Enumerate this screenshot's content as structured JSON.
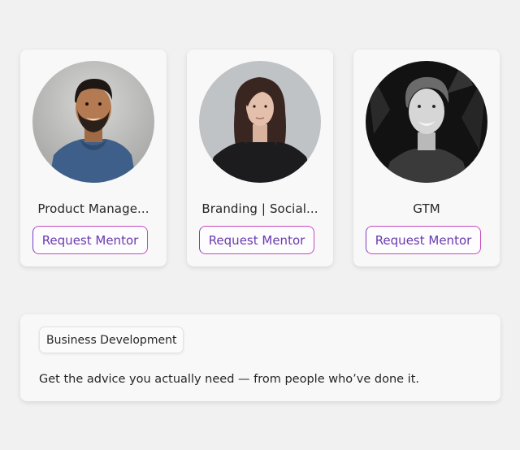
{
  "mentors": [
    {
      "title": "Product Manage...",
      "button_label": "Request Mentor",
      "avatar": "mentor-photo"
    },
    {
      "title": "Branding  | Social...",
      "button_label": "Request Mentor",
      "avatar": "mentor-photo"
    },
    {
      "title": "GTM",
      "button_label": "Request Mentor",
      "avatar": "mentor-photo"
    }
  ],
  "section": {
    "category": "Business Development",
    "tagline": "Get the advice you actually need — from people who’ve done it."
  },
  "colors": {
    "background": "#f1f1f1",
    "card": "#f8f8f8",
    "button_text": "#6a3aae",
    "button_border_start": "#7a3fbf",
    "button_border_end": "#c64bc0"
  }
}
